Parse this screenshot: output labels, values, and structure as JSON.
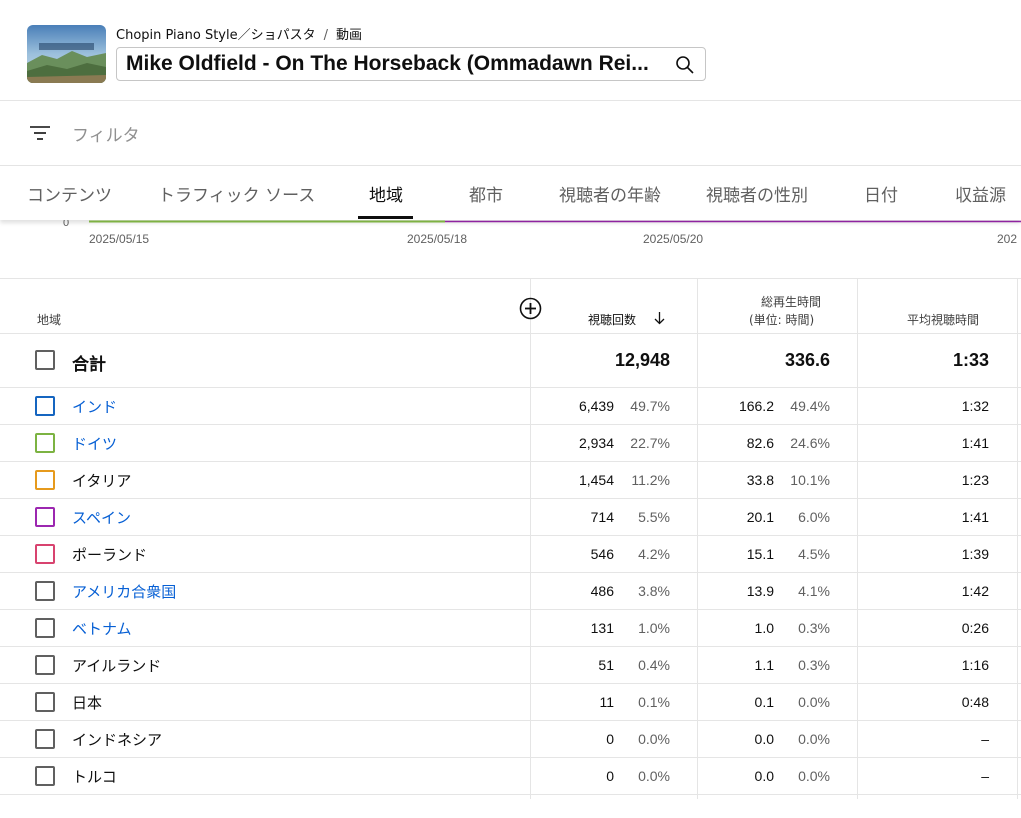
{
  "header": {
    "channel": "Chopin Piano Style／ショパスタ",
    "separator": "/",
    "section": "動画",
    "video_title": "Mike Oldfield - On The Horseback (Ommadawn Rei..."
  },
  "filter": {
    "label": "フィルタ"
  },
  "tabs": [
    {
      "label": "コンテンツ",
      "active": false
    },
    {
      "label": "トラフィック ソース",
      "active": false
    },
    {
      "label": "地域",
      "active": true
    },
    {
      "label": "都市",
      "active": false
    },
    {
      "label": "視聴者の年齢",
      "active": false
    },
    {
      "label": "視聴者の性別",
      "active": false
    },
    {
      "label": "日付",
      "active": false
    },
    {
      "label": "収益源",
      "active": false
    }
  ],
  "chart": {
    "y_tick": "0",
    "x_ticks": [
      "2025/05/15",
      "2025/05/18",
      "2025/05/20",
      "202"
    ],
    "colors": {
      "green": "#8bc34a",
      "purple": "#9c27b0"
    }
  },
  "table": {
    "headers": {
      "region": "地域",
      "views": "視聴回数",
      "watch_time_line1": "総再生時間",
      "watch_time_line2": "(単位: 時間)",
      "avg_duration": "平均視聴時間"
    },
    "total": {
      "name": "合計",
      "views": "12,948",
      "watch_time": "336.6",
      "avg": "1:33"
    },
    "rows": [
      {
        "name": "インド",
        "link": true,
        "color": "#1565c0",
        "views": "6,439",
        "views_pct": "49.7%",
        "watch_time": "166.2",
        "watch_pct": "49.4%",
        "avg": "1:32"
      },
      {
        "name": "ドイツ",
        "link": true,
        "color": "#7cb342",
        "views": "2,934",
        "views_pct": "22.7%",
        "watch_time": "82.6",
        "watch_pct": "24.6%",
        "avg": "1:41"
      },
      {
        "name": "イタリア",
        "link": false,
        "color": "#e69a1c",
        "views": "1,454",
        "views_pct": "11.2%",
        "watch_time": "33.8",
        "watch_pct": "10.1%",
        "avg": "1:23"
      },
      {
        "name": "スペイン",
        "link": true,
        "color": "#9c27b0",
        "views": "714",
        "views_pct": "5.5%",
        "watch_time": "20.1",
        "watch_pct": "6.0%",
        "avg": "1:41"
      },
      {
        "name": "ポーランド",
        "link": false,
        "color": "#d8436f",
        "views": "546",
        "views_pct": "4.2%",
        "watch_time": "15.1",
        "watch_pct": "4.5%",
        "avg": "1:39"
      },
      {
        "name": "アメリカ合衆国",
        "link": true,
        "color": "#606060",
        "views": "486",
        "views_pct": "3.8%",
        "watch_time": "13.9",
        "watch_pct": "4.1%",
        "avg": "1:42"
      },
      {
        "name": "ベトナム",
        "link": true,
        "color": "#606060",
        "views": "131",
        "views_pct": "1.0%",
        "watch_time": "1.0",
        "watch_pct": "0.3%",
        "avg": "0:26"
      },
      {
        "name": "アイルランド",
        "link": false,
        "color": "#606060",
        "views": "51",
        "views_pct": "0.4%",
        "watch_time": "1.1",
        "watch_pct": "0.3%",
        "avg": "1:16"
      },
      {
        "name": "日本",
        "link": false,
        "color": "#606060",
        "views": "11",
        "views_pct": "0.1%",
        "watch_time": "0.1",
        "watch_pct": "0.0%",
        "avg": "0:48"
      },
      {
        "name": "インドネシア",
        "link": false,
        "color": "#606060",
        "views": "0",
        "views_pct": "0.0%",
        "watch_time": "0.0",
        "watch_pct": "0.0%",
        "avg": "–"
      },
      {
        "name": "トルコ",
        "link": false,
        "color": "#606060",
        "views": "0",
        "views_pct": "0.0%",
        "watch_time": "0.0",
        "watch_pct": "0.0%",
        "avg": "–"
      }
    ]
  }
}
